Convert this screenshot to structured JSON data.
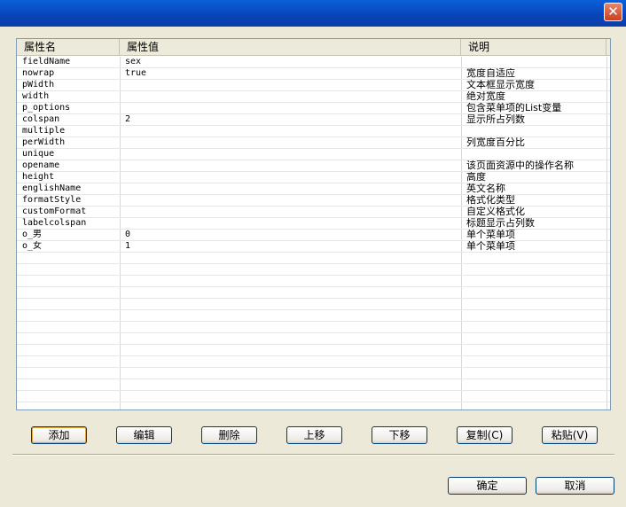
{
  "titlebar": {
    "close_symbol": "✕"
  },
  "grid": {
    "headers": [
      "属性名",
      "属性值",
      "说明"
    ],
    "rows": [
      [
        "fieldName",
        "sex",
        ""
      ],
      [
        "nowrap",
        "true",
        "宽度自适应"
      ],
      [
        "pWidth",
        "",
        "文本框显示宽度"
      ],
      [
        "width",
        "",
        "绝对宽度"
      ],
      [
        "p_options",
        "",
        "包含菜单项的List变量"
      ],
      [
        "colspan",
        "2",
        "显示所占列数"
      ],
      [
        "multiple",
        "",
        ""
      ],
      [
        "perWidth",
        "",
        "列宽度百分比"
      ],
      [
        "unique",
        "",
        ""
      ],
      [
        "opename",
        "",
        "该页面资源中的操作名称"
      ],
      [
        "height",
        "",
        "高度"
      ],
      [
        "englishName",
        "",
        "英文名称"
      ],
      [
        "formatStyle",
        "",
        "格式化类型"
      ],
      [
        "customFormat",
        "",
        "自定义格式化"
      ],
      [
        "labelcolspan",
        "",
        "标题显示占列数"
      ],
      [
        "o_男",
        "0",
        "单个菜单项"
      ],
      [
        "o_女",
        "1",
        "单个菜单项"
      ]
    ],
    "empty_rows": 14
  },
  "buttons": {
    "add": "添加",
    "edit": "编辑",
    "delete": "删除",
    "move_up": "上移",
    "move_down": "下移",
    "copy": "复制(C)",
    "paste": "粘贴(V)",
    "ok": "确定",
    "cancel": "取消"
  }
}
